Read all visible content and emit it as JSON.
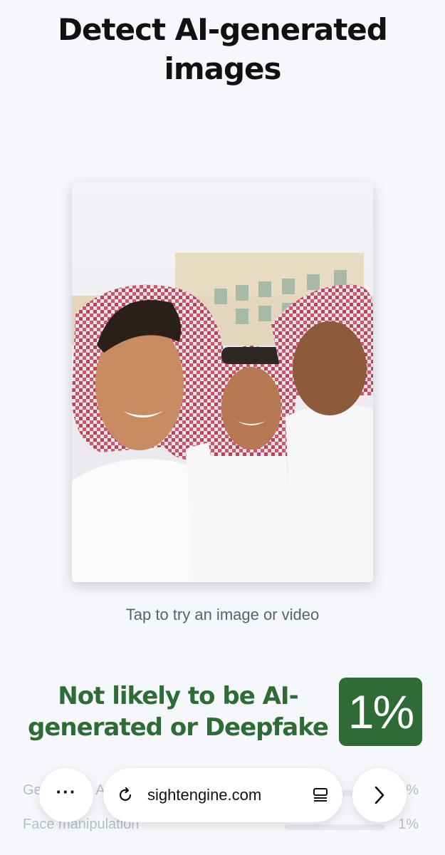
{
  "header": {
    "title_line1": "Detect AI-generated",
    "title_line2": "images"
  },
  "preview": {
    "hint": "Tap to try an image or video"
  },
  "result": {
    "verdict_line1": "Not likely to be AI-",
    "verdict_line2": "generated or Deepfake",
    "score_label": "1%",
    "color": "#2f6b37"
  },
  "metrics": [
    {
      "name": "Generative AI",
      "value": 0.01,
      "label": "1%"
    },
    {
      "name": "Face manipulation",
      "value": 0.01,
      "label": "1%"
    }
  ],
  "browser": {
    "more_icon": "ellipsis-icon",
    "reload_icon": "reload-icon",
    "url": "sightengine.com",
    "reader_icon": "reader-icon",
    "next_icon": "chevron-right-icon"
  }
}
